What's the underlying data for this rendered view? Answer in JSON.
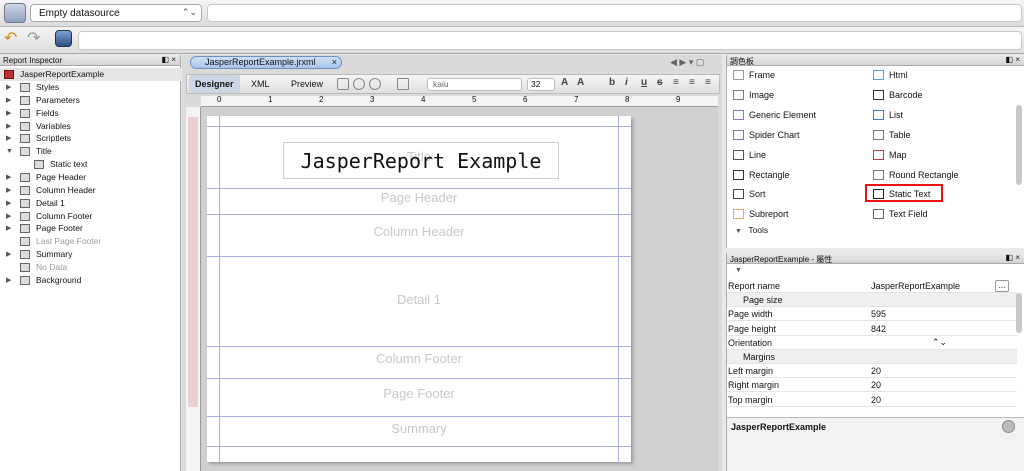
{
  "toolbar": {
    "datasource": "Empty datasource"
  },
  "report_inspector": {
    "title": "Report Inspector",
    "controls": "◧ ×",
    "root": "JasperReportExample",
    "items": [
      {
        "label": "Styles",
        "arrow": "▶",
        "dim": false
      },
      {
        "label": "Parameters",
        "arrow": "▶",
        "dim": false
      },
      {
        "label": "Fields",
        "arrow": "▶",
        "dim": false
      },
      {
        "label": "Variables",
        "arrow": "▶",
        "dim": false
      },
      {
        "label": "Scriptlets",
        "arrow": "▶",
        "dim": false
      },
      {
        "label": "Title",
        "arrow": "▼",
        "dim": false
      },
      {
        "label": "Static text",
        "arrow": "",
        "dim": false
      },
      {
        "label": "Page Header",
        "arrow": "▶",
        "dim": false
      },
      {
        "label": "Column Header",
        "arrow": "▶",
        "dim": false
      },
      {
        "label": "Detail 1",
        "arrow": "▶",
        "dim": false
      },
      {
        "label": "Column Footer",
        "arrow": "▶",
        "dim": false
      },
      {
        "label": "Page Footer",
        "arrow": "▶",
        "dim": false
      },
      {
        "label": "Last Page Footer",
        "arrow": "",
        "dim": true
      },
      {
        "label": "Summary",
        "arrow": "▶",
        "dim": false
      },
      {
        "label": "No Data",
        "arrow": "",
        "dim": true
      },
      {
        "label": "Background",
        "arrow": "▶",
        "dim": false
      }
    ]
  },
  "editor": {
    "tab_label": "JasperReportExample.jrxml",
    "tabs": [
      "Designer",
      "XML",
      "Preview"
    ],
    "font": "kaiu",
    "font_size": "32",
    "ruler_numbers": [
      "0",
      "1",
      "2",
      "3",
      "4",
      "5",
      "6",
      "7",
      "8",
      "9"
    ],
    "title_text": "JasperReport Example",
    "bands": [
      "Title",
      "Page Header",
      "Column Header",
      "Detail 1",
      "Column Footer",
      "Page Footer",
      "Summary"
    ]
  },
  "palette": {
    "title": "調色板",
    "controls": "◧ ×",
    "items_left": [
      "Frame",
      "Image",
      "Generic Element",
      "Spider Chart",
      "Line",
      "Rectangle",
      "Sort",
      "Subreport"
    ],
    "items_right": [
      "Html",
      "Barcode",
      "List",
      "Table",
      "Map",
      "Round Rectangle",
      "Static Text",
      "Text Field"
    ],
    "tools_label": "Tools"
  },
  "properties": {
    "title": "JasperReportExample - 屬性",
    "controls": "◧ ×",
    "rows": [
      {
        "key": "Report name",
        "value": "JasperReportExample",
        "group": false
      },
      {
        "key": "Page size",
        "value": "",
        "group": true
      },
      {
        "key": "Page width",
        "value": "595",
        "group": false
      },
      {
        "key": "Page height",
        "value": "842",
        "group": false
      },
      {
        "key": "Orientation",
        "value": "",
        "group": false
      },
      {
        "key": "Margins",
        "value": "",
        "group": true
      },
      {
        "key": "Left margin",
        "value": "20",
        "group": false
      },
      {
        "key": "Right margin",
        "value": "20",
        "group": false
      },
      {
        "key": "Top margin",
        "value": "20",
        "group": false
      }
    ],
    "selected": "JasperReportExample"
  }
}
